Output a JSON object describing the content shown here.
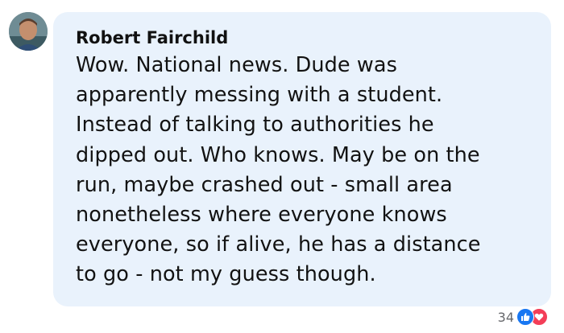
{
  "comment": {
    "author": "Robert Fairchild",
    "lines": [
      "Wow. National news. Dude was",
      "apparently messing with a student.",
      "Instead of talking to authorities he",
      "dipped out. Who knows. May be on the",
      "run, maybe crashed out - small area",
      "nonetheless where everyone knows",
      "everyone, so if alive, he has a distance",
      "to go - not my guess though."
    ]
  },
  "reactions": {
    "count": "34",
    "icons": [
      "like-icon",
      "love-icon"
    ],
    "colors": {
      "like": "#1877f2",
      "love": "#f33e58"
    }
  },
  "colors": {
    "bubble": "#e9f2fc",
    "text": "#121212"
  }
}
